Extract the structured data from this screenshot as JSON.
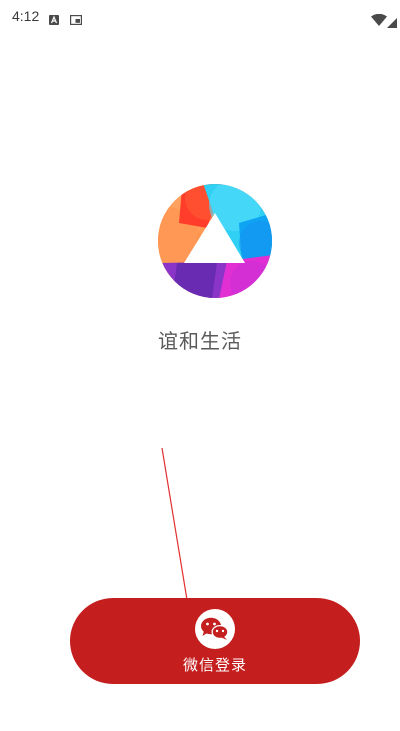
{
  "status_bar": {
    "time": "4:12",
    "icons": [
      "accessibility-a-icon",
      "picture-in-picture-icon",
      "wifi-icon",
      "signal-icon"
    ]
  },
  "logo": {
    "icon": "app-logo-triangle-circle",
    "colors": [
      "#ff4b2e",
      "#ffa15a",
      "#2fd3f5",
      "#12a6f5",
      "#7a33c8",
      "#e02ad5"
    ]
  },
  "app": {
    "name": "谊和生活"
  },
  "login": {
    "button_label": "微信登录",
    "icon": "wechat-icon",
    "button_color": "#c41e1e"
  }
}
